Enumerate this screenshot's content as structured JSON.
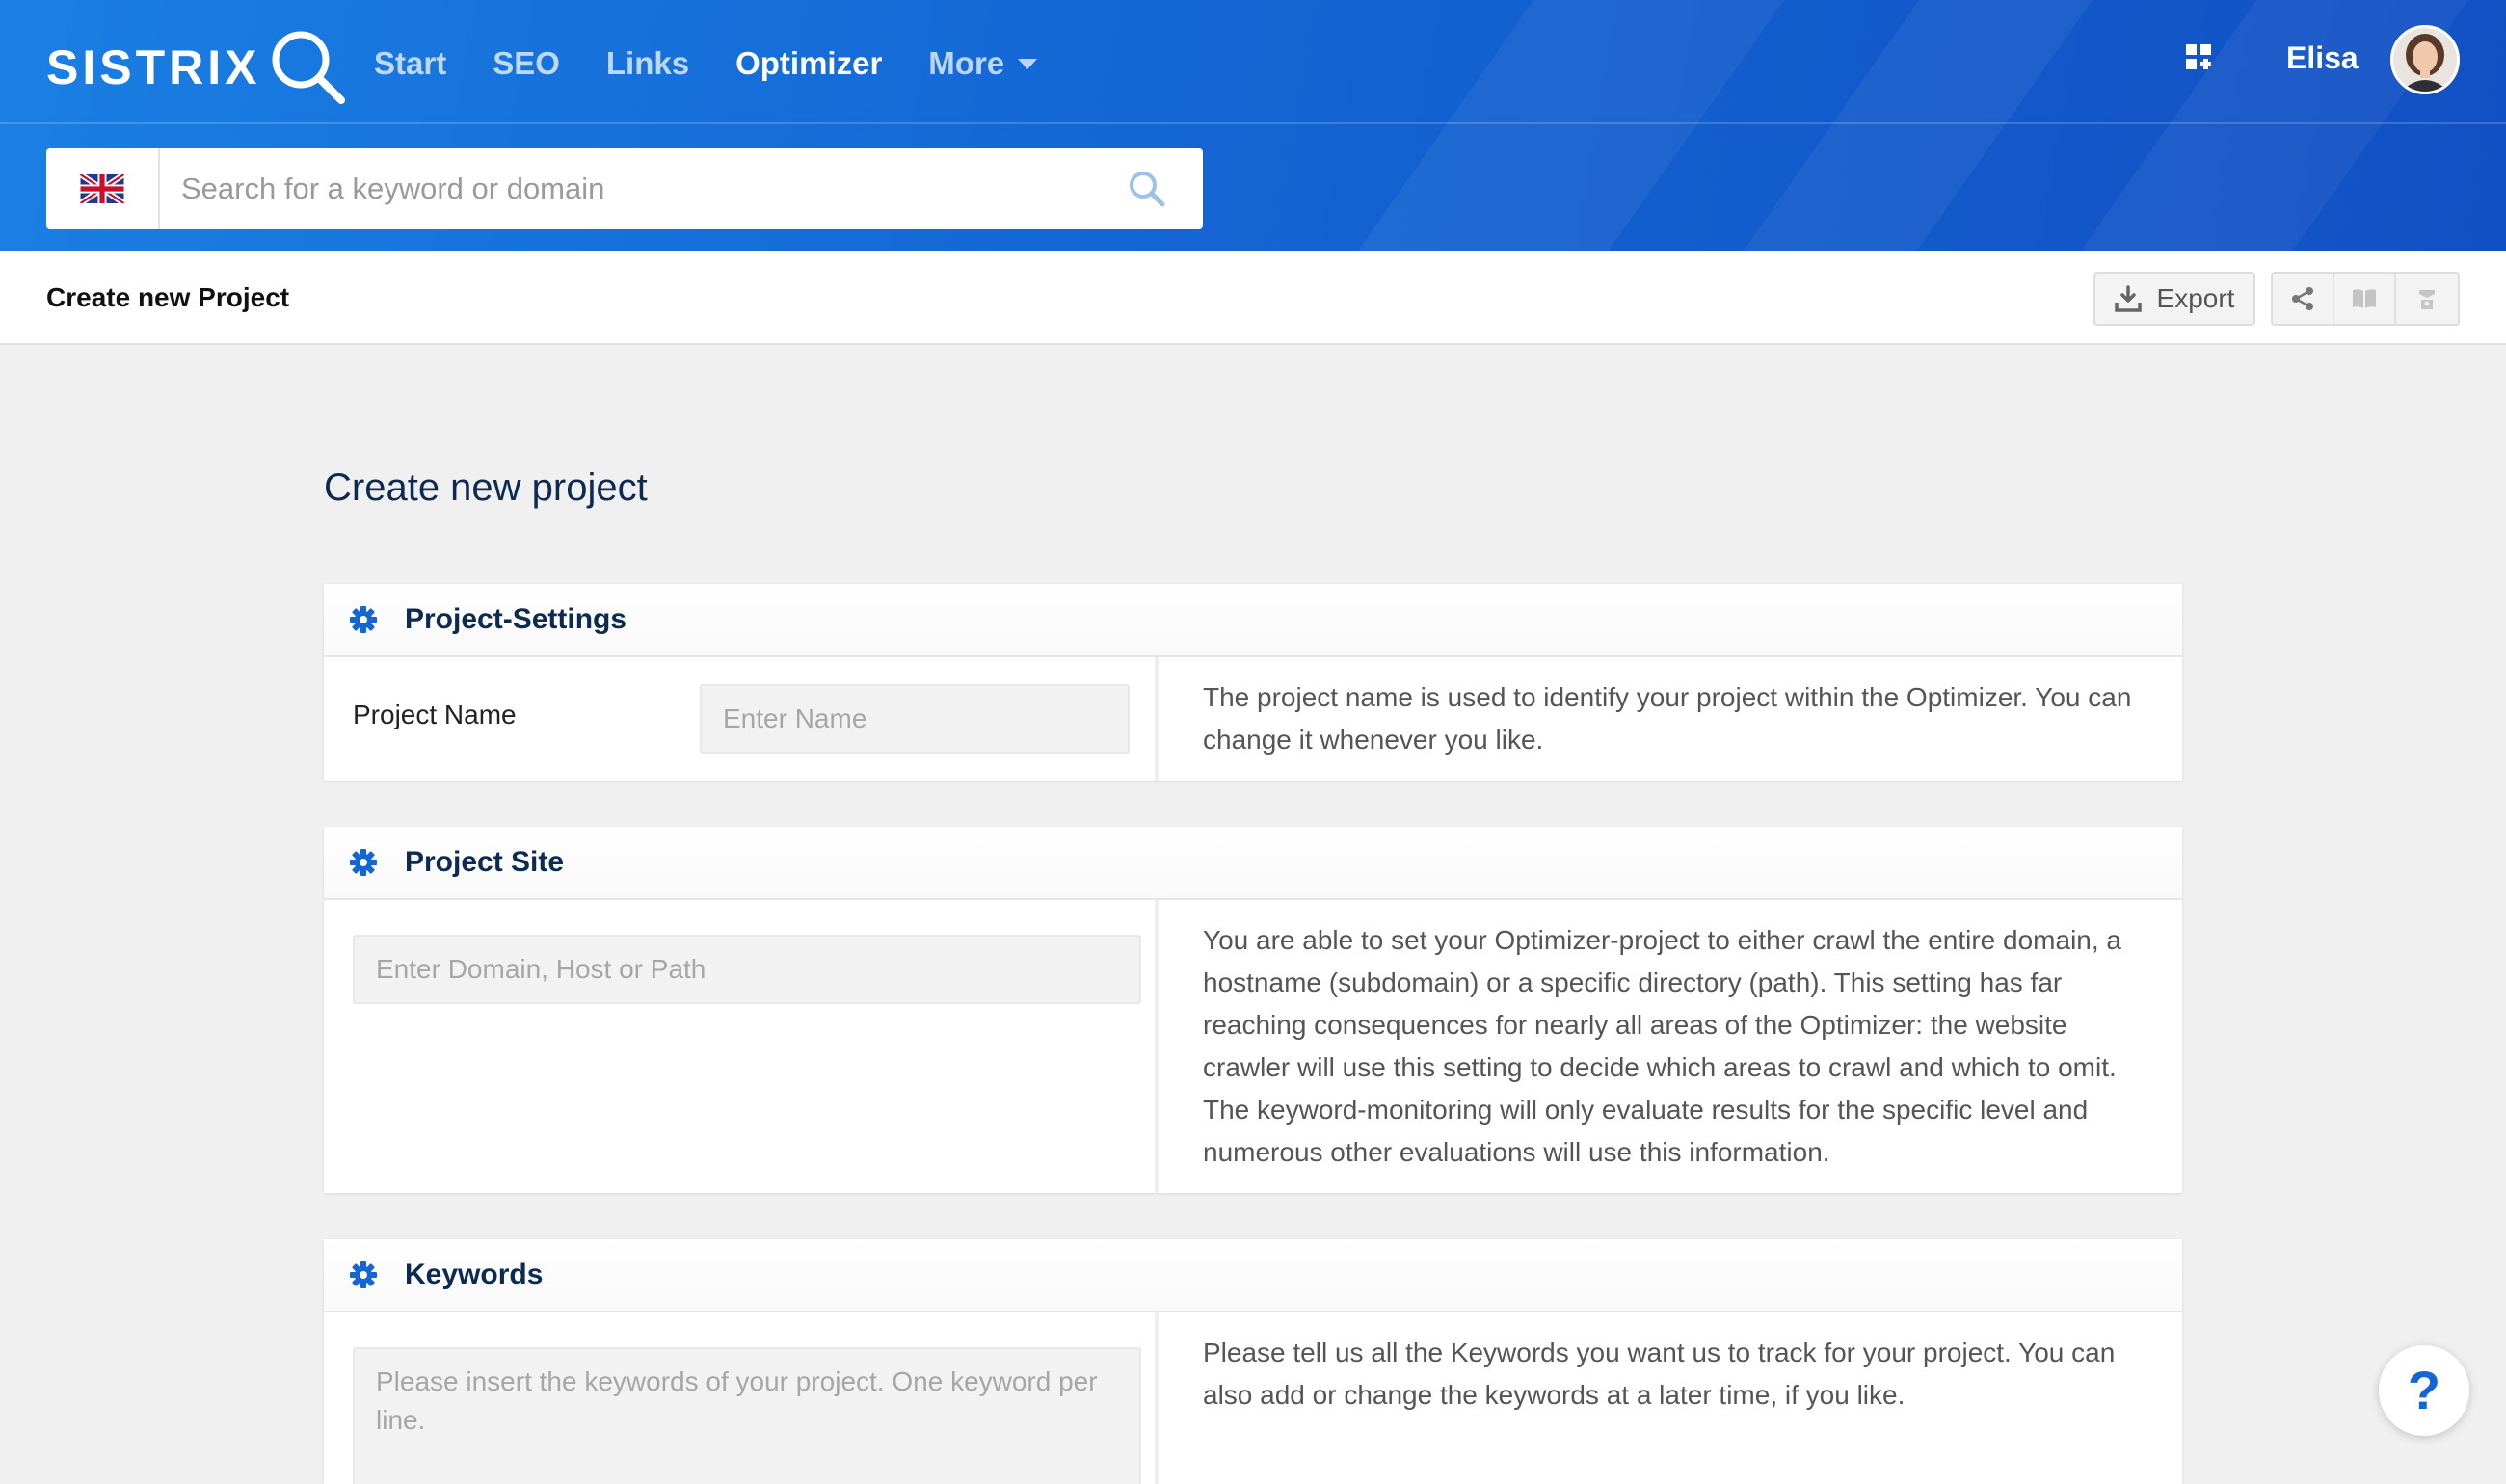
{
  "brand": {
    "logo_text": "SISTRIX"
  },
  "nav": {
    "items": [
      {
        "label": "Start",
        "active": false
      },
      {
        "label": "SEO",
        "active": false
      },
      {
        "label": "Links",
        "active": false
      },
      {
        "label": "Optimizer",
        "active": true
      },
      {
        "label": "More",
        "active": false
      }
    ]
  },
  "user": {
    "name": "Elisa"
  },
  "search": {
    "placeholder": "Search for a keyword or domain",
    "value": "",
    "country_flag": "uk-flag-icon"
  },
  "subbar": {
    "title": "Create new Project",
    "export_label": "Export"
  },
  "page": {
    "title": "Create new project"
  },
  "sections": {
    "settings": {
      "title": "Project-Settings",
      "field_label": "Project Name",
      "placeholder": "Enter Name",
      "value": "",
      "help": "The project name is used to identify your project within the Optimizer. You can change it whenever you like."
    },
    "site": {
      "title": "Project Site",
      "placeholder": "Enter Domain, Host or Path",
      "value": "",
      "help": "You are able to set your Optimizer-project to either crawl the entire domain, a hostname (subdomain) or a specific directory (path). This setting has far reaching consequences for nearly all areas of the Optimizer: the website crawler will use this setting to decide which areas to crawl and which to omit. The keyword-monitoring will only evaluate results for the specific level and numerous other evaluations will use this information."
    },
    "keywords": {
      "title": "Keywords",
      "placeholder": "Please insert the keywords of your project. One keyword per line.",
      "value": "",
      "help": "Please tell us all the Keywords you want us to track for your project. You can also add or change the keywords at a later time, if you like."
    }
  },
  "help_button": {
    "label": "?"
  },
  "colors": {
    "brand_blue": "#1466d4",
    "title_navy": "#0d2a52",
    "page_bg": "#f0f0f0"
  }
}
